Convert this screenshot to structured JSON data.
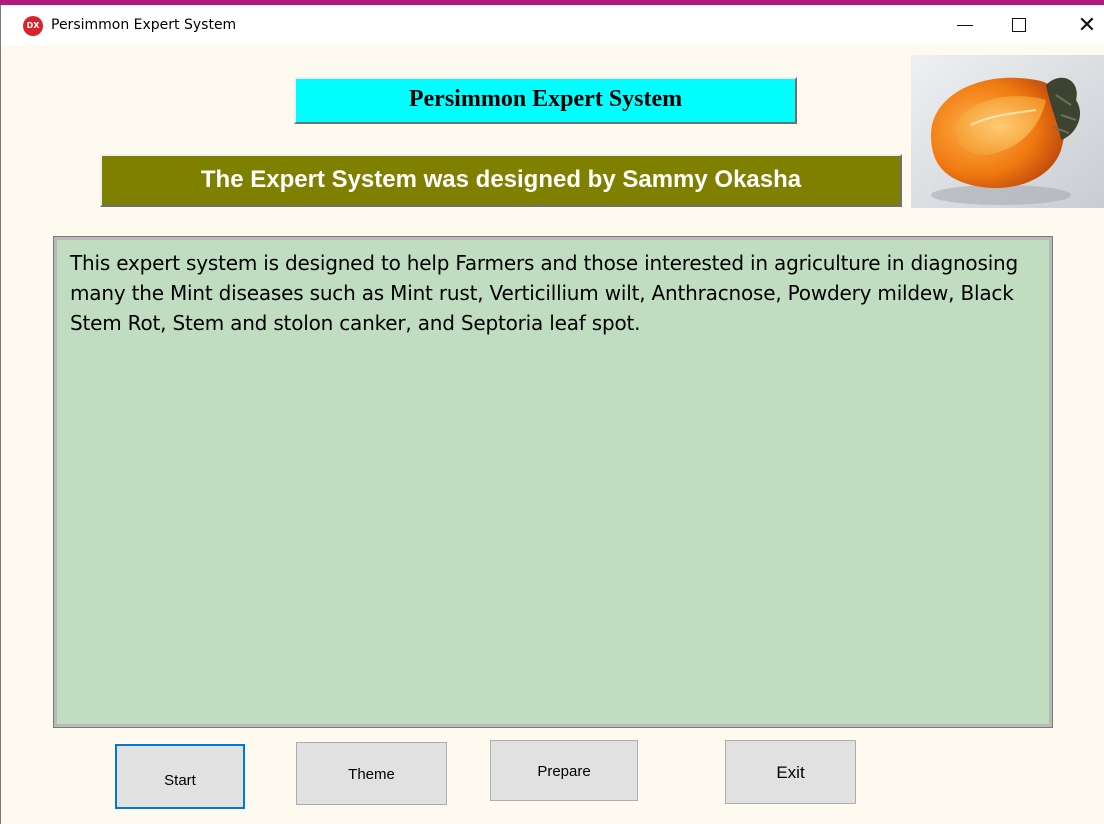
{
  "window": {
    "title": "Persimmon Expert System",
    "icon_label": "DX",
    "controls": {
      "minimize": "minimize-icon",
      "maximize": "maximize-icon",
      "close": "close-icon"
    }
  },
  "header": {
    "title": "Persimmon Expert System",
    "credit": "The Expert System was designed by Sammy Okasha"
  },
  "description": "This expert system is designed to help Farmers and those interested in agriculture in diagnosing many the Mint diseases such as Mint rust, Verticillium wilt, Anthracnose, Powdery mildew, Black Stem Rot, Stem and stolon canker, and Septoria leaf spot.",
  "buttons": {
    "start": "Start",
    "theme": "Theme",
    "prepare": "Prepare",
    "exit": "Exit"
  },
  "colors": {
    "header_bg": "#00ffff",
    "credit_bg": "#808000",
    "panel_bg": "#c0ddc1",
    "window_bg": "#fffaf0",
    "accent_stripe": "#b01a7b"
  }
}
